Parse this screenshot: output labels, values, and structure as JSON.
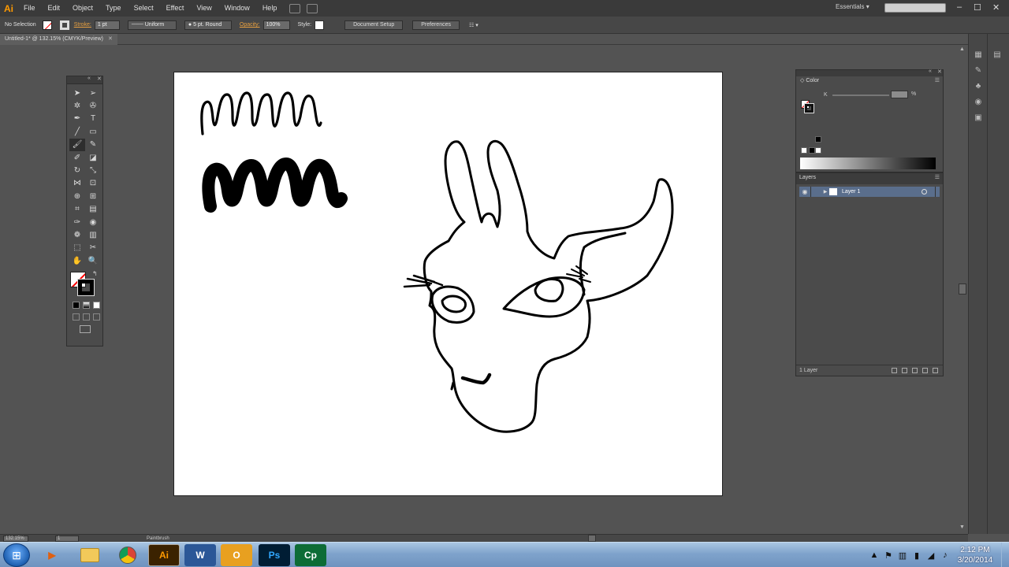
{
  "app": {
    "logo": "Ai",
    "menus": [
      "File",
      "Edit",
      "Object",
      "Type",
      "Select",
      "Effect",
      "View",
      "Window",
      "Help"
    ],
    "workspace": "Essentials",
    "window_controls": {
      "minimize": "–",
      "maximize": "☐",
      "close": "✕"
    }
  },
  "control_bar": {
    "selection": "No Selection",
    "stroke_label": "Stroke:",
    "stroke_weight": "1 pt",
    "profile": "Uniform",
    "brush": "5 pt. Round",
    "opacity_label": "Opacity:",
    "opacity_value": "100%",
    "style_label": "Style:",
    "doc_setup": "Document Setup",
    "preferences": "Preferences"
  },
  "document": {
    "tab_title": "Untitled-1* @ 132.15% (CMYK/Preview)",
    "close": "✕"
  },
  "tools": {
    "icons": [
      "selection-tool",
      "direct-selection-tool",
      "magic-wand-tool",
      "lasso-tool",
      "pen-tool",
      "type-tool",
      "line-segment-tool",
      "rectangle-tool",
      "paintbrush-tool",
      "pencil-tool",
      "blob-brush-tool",
      "eraser-tool",
      "rotate-tool",
      "scale-tool",
      "width-tool",
      "free-transform-tool",
      "shape-builder-tool",
      "perspective-grid-tool",
      "mesh-tool",
      "gradient-tool",
      "eyedropper-tool",
      "blend-tool",
      "symbol-sprayer-tool",
      "column-graph-tool",
      "artboard-tool",
      "slice-tool",
      "hand-tool",
      "zoom-tool"
    ],
    "glyphs": [
      "➤",
      "➢",
      "✲",
      "✇",
      "✒",
      "T",
      "╱",
      "▭",
      "🖌",
      "✎",
      "✐",
      "◪",
      "↻",
      "⤡",
      "⋈",
      "⊡",
      "⊕",
      "⊞",
      "⌗",
      "▤",
      "✑",
      "◉",
      "❁",
      "▥",
      "⬚",
      "✂",
      "✋",
      "🔍"
    ]
  },
  "color_panel": {
    "tab": "Color",
    "channel": "K",
    "unit": "%"
  },
  "layers_panel": {
    "tab": "Layers",
    "layer_name": "Layer 1",
    "footer": "1 Layer",
    "selection_color": "#5a6e8c"
  },
  "status_bar": {
    "zoom": "132.15%",
    "page": "1",
    "tool": "Paintbrush"
  },
  "taskbar": {
    "apps": [
      "windows-media-player",
      "file-explorer",
      "chrome",
      "illustrator",
      "word",
      "outlook",
      "photoshop",
      "captivate"
    ],
    "app_labels": [
      "▶",
      "",
      "",
      "Ai",
      "W",
      "O",
      "Ps",
      "Cp"
    ],
    "time": "2:12 PM",
    "date": "3/20/2014"
  },
  "colors": {
    "ui_dark": "#3a3a3a",
    "ui_panel": "#4b4b4b",
    "ui_bg": "#535353",
    "ai_orange": "#ff9a00"
  }
}
